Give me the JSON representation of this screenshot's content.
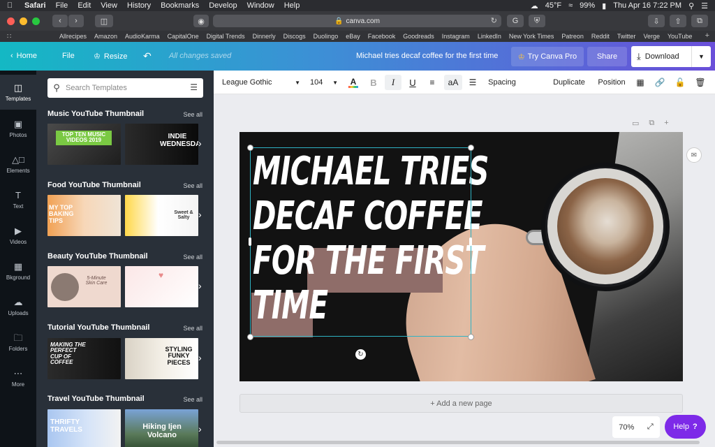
{
  "menubar": {
    "app": "Safari",
    "items": [
      "File",
      "Edit",
      "View",
      "History",
      "Bookmarks",
      "Develop",
      "Window",
      "Help"
    ],
    "weather": "45°F",
    "battery": "99%",
    "datetime": "Thu Apr 16  7:22 PM"
  },
  "browser": {
    "url": "canva.com",
    "bookmarks": [
      "Allrecipes",
      "Amazon",
      "AudioKarma",
      "CapitalOne",
      "Digital Trends",
      "Dinnerly",
      "Discogs",
      "Duolingo",
      "eBay",
      "Facebook",
      "Goodreads",
      "Instagram",
      "LinkedIn",
      "New York Times",
      "Patreon",
      "Reddit",
      "Twitter",
      "Verge",
      "YouTube"
    ]
  },
  "header": {
    "home": "Home",
    "file": "File",
    "resize": "Resize",
    "saved_status": "All changes saved",
    "doc_title": "Michael tries decaf coffee for the first time",
    "pro": "Try Canva Pro",
    "share": "Share",
    "download": "Download"
  },
  "rail": {
    "items": [
      "Templates",
      "Photos",
      "Elements",
      "Text",
      "Videos",
      "Bkground",
      "Uploads",
      "Folders",
      "More"
    ]
  },
  "panel": {
    "search_placeholder": "Search Templates",
    "see_all": "See all",
    "sections": [
      {
        "title": "Music YouTube Thumbnail",
        "thumbs": [
          "TOP TEN MUSIC VIDEOS 2019",
          "INDIE WEDNESDAYS"
        ]
      },
      {
        "title": "Food YouTube Thumbnail",
        "thumbs": [
          "MY TOP BAKING TIPS",
          "Sweet & Salty"
        ]
      },
      {
        "title": "Beauty YouTube Thumbnail",
        "thumbs": [
          "5-Minute Skin Care",
          ""
        ]
      },
      {
        "title": "Tutorial YouTube Thumbnail",
        "thumbs": [
          "MAKING THE PERFECT CUP OF COFFEE",
          "STYLING FUNKY PIECES"
        ]
      },
      {
        "title": "Travel YouTube Thumbnail",
        "thumbs": [
          "THRIFTY TRAVELS",
          "Hiking Ijen Volcano"
        ]
      }
    ]
  },
  "toolbar": {
    "font": "League Gothic",
    "size": "104",
    "bold": "B",
    "italic": "I",
    "underline": "U",
    "case": "aA",
    "spacing": "Spacing",
    "duplicate": "Duplicate",
    "position": "Position"
  },
  "design": {
    "headline": [
      "MICHAEL TRIES",
      "DECAF COFFEE",
      "FOR THE FIRST",
      "TIME"
    ]
  },
  "canvas": {
    "add_page": "+ Add a new page",
    "zoom": "70%",
    "help": "Help",
    "help_icon": "?"
  }
}
